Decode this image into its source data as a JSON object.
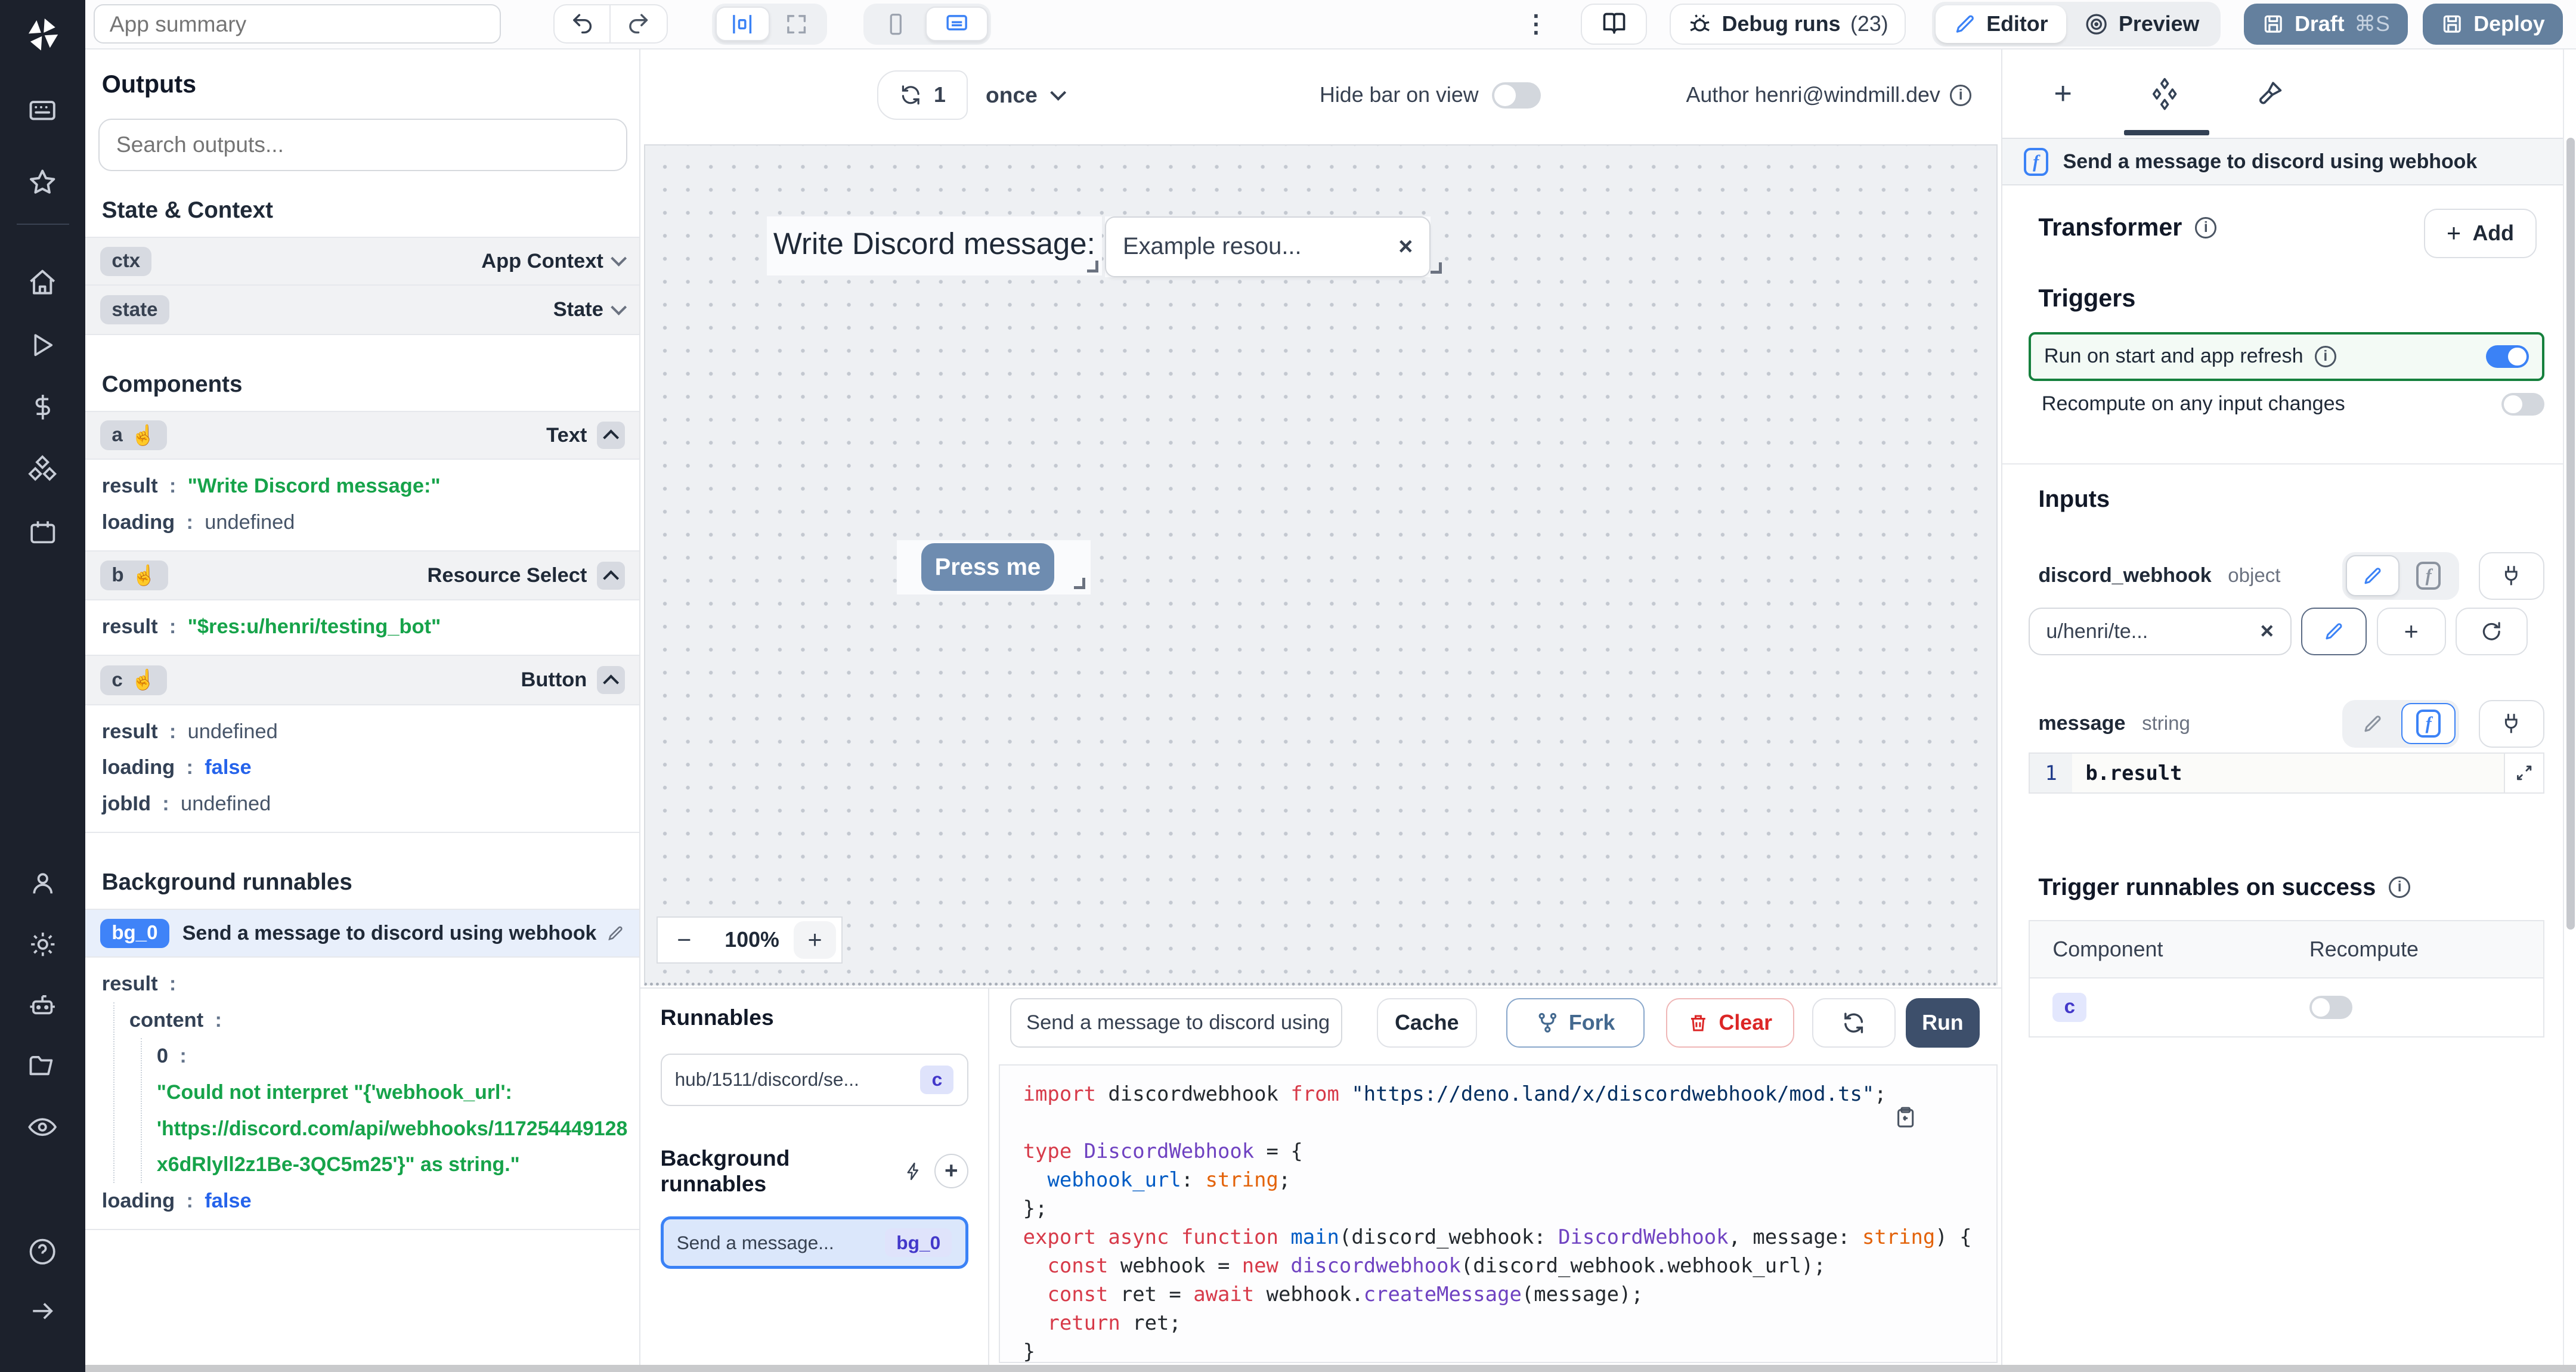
{
  "topbar": {
    "app_summary_placeholder": "App summary",
    "debug_runs": "Debug runs",
    "debug_count": "(23)",
    "editor": "Editor",
    "preview": "Preview",
    "draft": "Draft",
    "draft_shortcut": "⌘S",
    "deploy": "Deploy",
    "kebab": "⋮"
  },
  "outputs": {
    "title": "Outputs",
    "search_placeholder": "Search outputs...",
    "state_context": "State & Context",
    "ctx_badge": "ctx",
    "ctx_type": "App Context",
    "state_badge": "state",
    "state_type": "State",
    "components_title": "Components",
    "a": {
      "badge": "a",
      "type": "Text",
      "rows": [
        {
          "k": "result",
          "v": "\"Write Discord message:\""
        },
        {
          "k": "loading",
          "v": "undefined"
        }
      ]
    },
    "b": {
      "badge": "b",
      "type": "Resource Select",
      "rows": [
        {
          "k": "result",
          "v": "\"$res:u/henri/testing_bot\""
        }
      ]
    },
    "c": {
      "badge": "c",
      "type": "Button",
      "rows": [
        {
          "k": "result",
          "v": "undefined"
        },
        {
          "k": "loading",
          "v": "false"
        },
        {
          "k": "jobId",
          "v": "undefined"
        }
      ]
    },
    "bg_title": "Background runnables",
    "bg0": {
      "badge": "bg_0",
      "title": "Send a message to discord using webhook",
      "k_result": "result",
      "k_content": "content",
      "k_zero": "0",
      "line1": "\"Could not interpret \"{'webhook_url':",
      "line2": "'https://discord.com/api/webhooks/117254449128",
      "line3": "x6dRlyll2z1Be-3QC5m25'}\" as string.\"",
      "k_loading": "loading",
      "v_loading": "false"
    }
  },
  "canvas": {
    "refresh_count": "1",
    "interval": "once",
    "hide_bar": "Hide bar on view",
    "author": "Author henri@windmill.dev",
    "text_component": "Write Discord message:",
    "select_value": "Example resou...",
    "select_clear": "×",
    "button_label": "Press me",
    "zoom_minus": "−",
    "zoom_level": "100%",
    "zoom_plus": "+"
  },
  "runnables": {
    "title": "Runnables",
    "item_path": "hub/1511/discord/se...",
    "item_badge": "c",
    "bg_title": "Background runnables",
    "bg_plus": "+",
    "bg_item": "Send a message...",
    "bg_badge": "bg_0"
  },
  "code_panel": {
    "name_value": "Send a message to discord using",
    "cache": "Cache",
    "fork": "Fork",
    "clear": "Clear",
    "run": "Run",
    "lines": [
      [
        [
          "k",
          "import"
        ],
        [
          "p",
          " discordwebhook "
        ],
        [
          "k",
          "from"
        ],
        [
          "p",
          " "
        ],
        [
          "s",
          "\"https://deno.land/x/discordwebhook/mod.ts\""
        ],
        [
          "p",
          ";"
        ]
      ],
      [],
      [
        [
          "k",
          "type"
        ],
        [
          "p",
          " "
        ],
        [
          "t",
          "DiscordWebhook"
        ],
        [
          "p",
          " = {"
        ]
      ],
      [
        [
          "p",
          "  "
        ],
        [
          "f",
          "webhook_url"
        ],
        [
          "p",
          ": "
        ],
        [
          "o",
          "string"
        ],
        [
          "p",
          ";"
        ]
      ],
      [
        [
          "p",
          "};"
        ]
      ],
      [
        [
          "k",
          "export"
        ],
        [
          "p",
          " "
        ],
        [
          "k",
          "async"
        ],
        [
          "p",
          " "
        ],
        [
          "k",
          "function"
        ],
        [
          "p",
          " "
        ],
        [
          "f",
          "main"
        ],
        [
          "p",
          "(discord_webhook: "
        ],
        [
          "t",
          "DiscordWebhook"
        ],
        [
          "p",
          ", message: "
        ],
        [
          "o",
          "string"
        ],
        [
          "p",
          ") {"
        ]
      ],
      [
        [
          "p",
          "  "
        ],
        [
          "k",
          "const"
        ],
        [
          "p",
          " webhook = "
        ],
        [
          "k",
          "new"
        ],
        [
          "p",
          " "
        ],
        [
          "t",
          "discordwebhook"
        ],
        [
          "p",
          "(discord_webhook.webhook_url);"
        ]
      ],
      [
        [
          "p",
          "  "
        ],
        [
          "k",
          "const"
        ],
        [
          "p",
          " ret = "
        ],
        [
          "k",
          "await"
        ],
        [
          "p",
          " webhook."
        ],
        [
          "t",
          "createMessage"
        ],
        [
          "p",
          "(message);"
        ]
      ],
      [
        [
          "p",
          "  "
        ],
        [
          "k",
          "return"
        ],
        [
          "p",
          " ret;"
        ]
      ],
      [
        [
          "p",
          "}"
        ]
      ]
    ]
  },
  "right": {
    "header": "Send a message to discord using webhook",
    "transformer": "Transformer",
    "add_plus": "+",
    "add": "Add",
    "triggers": "Triggers",
    "run_on_start": "Run on start and app refresh",
    "recompute_any": "Recompute on any input changes",
    "inputs": "Inputs",
    "dw_name": "discord_webhook",
    "dw_type": "object",
    "dw_value": "u/henri/te...",
    "dw_clear": "×",
    "msg_name": "message",
    "msg_type": "string",
    "msg_line_no": "1",
    "msg_code": "b.result",
    "trigger_success": "Trigger runnables on success",
    "col_component": "Component",
    "col_recompute": "Recompute",
    "row_badge": "c",
    "info_i": "i",
    "f_glyph": "f"
  }
}
